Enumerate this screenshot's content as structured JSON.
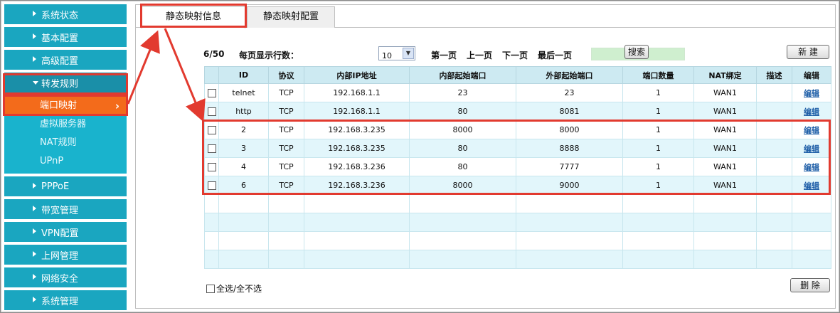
{
  "sidebar": {
    "items_top": [
      {
        "label": "系统状态"
      },
      {
        "label": "基本配置"
      },
      {
        "label": "高级配置"
      }
    ],
    "open_item": {
      "label": "转发规则"
    },
    "sub_items": [
      {
        "label": "端口映射",
        "active": true
      },
      {
        "label": "虚拟服务器"
      },
      {
        "label": "NAT规则"
      },
      {
        "label": "UPnP"
      }
    ],
    "items_bottom": [
      {
        "label": "PPPoE"
      },
      {
        "label": "带宽管理"
      },
      {
        "label": "VPN配置"
      },
      {
        "label": "上网管理"
      },
      {
        "label": "网络安全"
      },
      {
        "label": "系统管理"
      }
    ]
  },
  "tabs": [
    {
      "label": "静态映射信息",
      "active": true
    },
    {
      "label": "静态映射配置"
    }
  ],
  "toolbar": {
    "count": "6/50",
    "rows_label": "每页显示行数：",
    "rows_value": "10",
    "first": "第一页",
    "prev": "上一页",
    "next": "下一页",
    "last": "最后一页",
    "search_button": "搜索",
    "new_button": "新 建"
  },
  "table": {
    "headers": [
      "",
      "ID",
      "协议",
      "内部IP地址",
      "内部起始端口",
      "外部起始端口",
      "端口数量",
      "NAT绑定",
      "描述",
      "编辑"
    ],
    "rows": [
      {
        "id": "telnet",
        "protocol": "TCP",
        "ip": "192.168.1.1",
        "in_port": "23",
        "out_port": "23",
        "count": "1",
        "nat": "WAN1",
        "desc": "",
        "edit": "编辑"
      },
      {
        "id": "http",
        "protocol": "TCP",
        "ip": "192.168.1.1",
        "in_port": "80",
        "out_port": "8081",
        "count": "1",
        "nat": "WAN1",
        "desc": "",
        "edit": "编辑"
      },
      {
        "id": "2",
        "protocol": "TCP",
        "ip": "192.168.3.235",
        "in_port": "8000",
        "out_port": "8000",
        "count": "1",
        "nat": "WAN1",
        "desc": "",
        "edit": "编辑"
      },
      {
        "id": "3",
        "protocol": "TCP",
        "ip": "192.168.3.235",
        "in_port": "80",
        "out_port": "8888",
        "count": "1",
        "nat": "WAN1",
        "desc": "",
        "edit": "编辑"
      },
      {
        "id": "4",
        "protocol": "TCP",
        "ip": "192.168.3.236",
        "in_port": "80",
        "out_port": "7777",
        "count": "1",
        "nat": "WAN1",
        "desc": "",
        "edit": "编辑"
      },
      {
        "id": "6",
        "protocol": "TCP",
        "ip": "192.168.3.236",
        "in_port": "8000",
        "out_port": "9000",
        "count": "1",
        "nat": "WAN1",
        "desc": "",
        "edit": "编辑"
      }
    ]
  },
  "footer": {
    "select_all": "全选/全不选",
    "delete_button": "删 除"
  },
  "colors": {
    "sidebar": "#1aa6c0",
    "active_sub": "#f36b1b",
    "highlight": "#e23a2f"
  }
}
